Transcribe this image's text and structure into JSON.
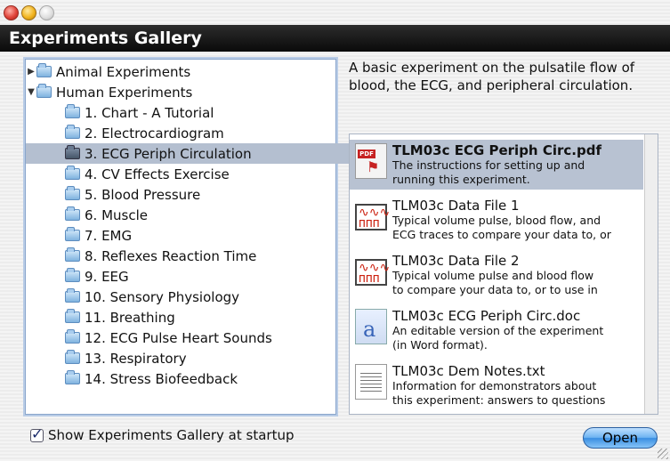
{
  "window": {
    "title": "Experiments Gallery"
  },
  "tree": {
    "groups": [
      {
        "label": "Animal Experiments",
        "expanded": false
      },
      {
        "label": "Human Experiments",
        "expanded": true
      }
    ],
    "items": [
      "1. Chart - A Tutorial",
      "2. Electrocardiogram",
      "3. ECG Periph Circulation",
      "4. CV Effects Exercise",
      "5. Blood Pressure",
      "6. Muscle",
      "7. EMG",
      "8. Reflexes Reaction Time",
      "9. EEG",
      "10. Sensory Physiology",
      "11. Breathing",
      "12. ECG Pulse Heart Sounds",
      "13. Respiratory",
      "14. Stress Biofeedback"
    ],
    "selected_item": "3. ECG Periph Circulation"
  },
  "description": "A basic experiment on the pulsatile flow of blood, the ECG, and peripheral circulation.",
  "files": [
    {
      "name": "TLM03c ECG Periph Circ.pdf",
      "line1": "The instructions for setting up and",
      "line2": "running this experiment.",
      "icon": "pdf-icon"
    },
    {
      "name": "TLM03c Data File 1",
      "line1": "Typical volume pulse, blood flow, and",
      "line2": "ECG traces to compare your data to, or",
      "icon": "data-file-icon"
    },
    {
      "name": "TLM03c Data File 2",
      "line1": "Typical volume pulse and blood flow",
      "line2": "to compare your data to, or to use in",
      "icon": "data-file-icon"
    },
    {
      "name": "TLM03c ECG Periph Circ.doc",
      "line1": "An editable version of the experiment",
      "line2": "(in Word format).",
      "icon": "word-doc-icon"
    },
    {
      "name": "TLM03c Dem Notes.txt",
      "line1": "Information for demonstrators about",
      "line2": "this experiment: answers to questions",
      "icon": "text-file-icon"
    }
  ],
  "startup_checkbox": {
    "label": "Show Experiments Gallery at startup",
    "checked": true
  },
  "open_button": {
    "label": "Open"
  },
  "colors": {
    "header_bg": "#0a0a0a",
    "selection": "#b4bfd0",
    "button_blue": "#3a8ee2"
  }
}
